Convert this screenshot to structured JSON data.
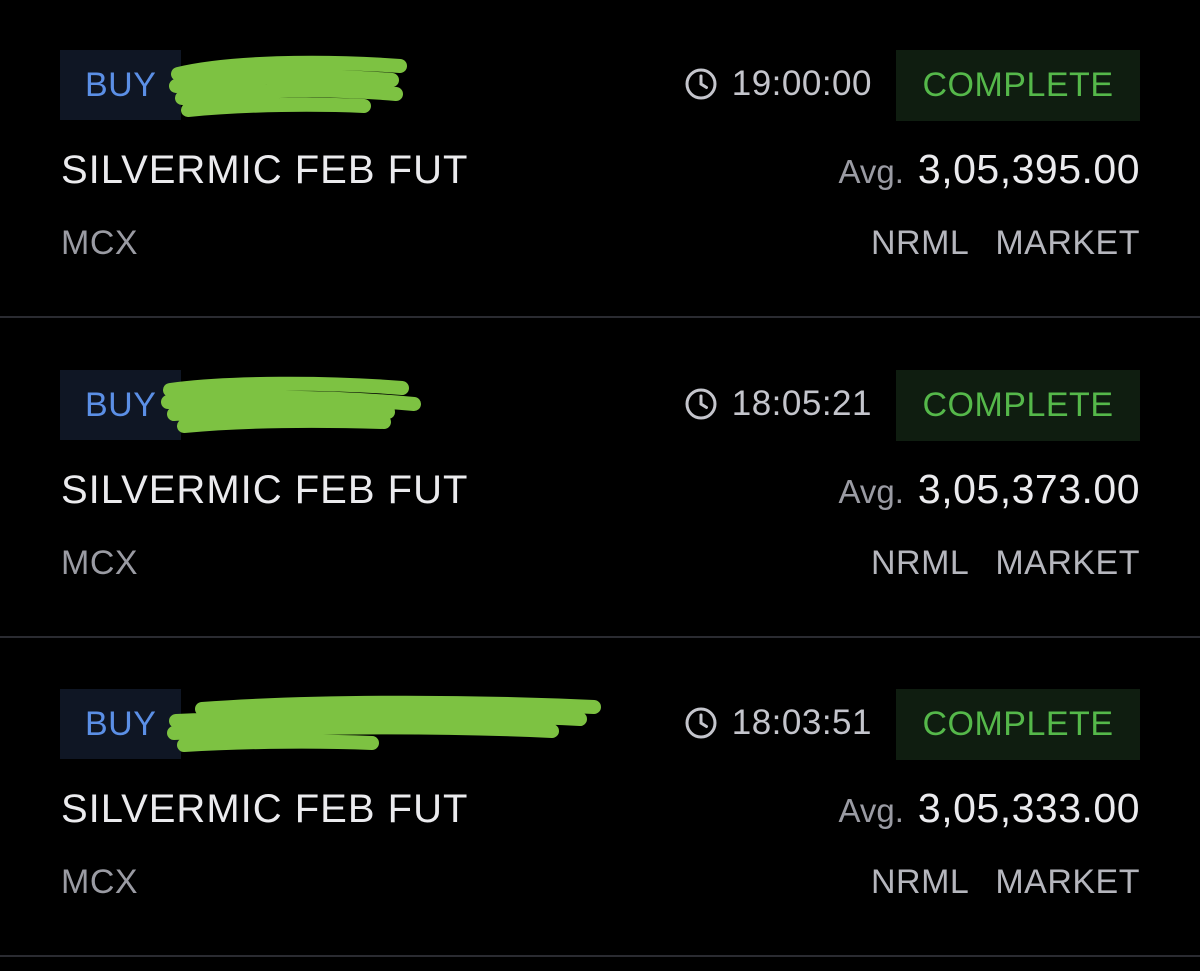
{
  "colors": {
    "background": "#000000",
    "buy": "#5b8fe6",
    "buy_badge_bg": "#0f1624",
    "complete": "#55b84a",
    "complete_badge_bg": "#0f1d10",
    "redaction": "#7dc242",
    "divider": "#2a2b31"
  },
  "orders": [
    {
      "side": "BUY",
      "time": "19:00:00",
      "status": "COMPLETE",
      "instrument": "SILVERMIC FEB FUT",
      "avg_label": "Avg.",
      "avg_price": "3,05,395.00",
      "exchange": "MCX",
      "product": "NRML",
      "order_type": "MARKET"
    },
    {
      "side": "BUY",
      "time": "18:05:21",
      "status": "COMPLETE",
      "instrument": "SILVERMIC FEB FUT",
      "avg_label": "Avg.",
      "avg_price": "3,05,373.00",
      "exchange": "MCX",
      "product": "NRML",
      "order_type": "MARKET"
    },
    {
      "side": "BUY",
      "time": "18:03:51",
      "status": "COMPLETE",
      "instrument": "SILVERMIC FEB FUT",
      "avg_label": "Avg.",
      "avg_price": "3,05,333.00",
      "exchange": "MCX",
      "product": "NRML",
      "order_type": "MARKET"
    }
  ],
  "icons": {
    "time": "clock-icon"
  }
}
